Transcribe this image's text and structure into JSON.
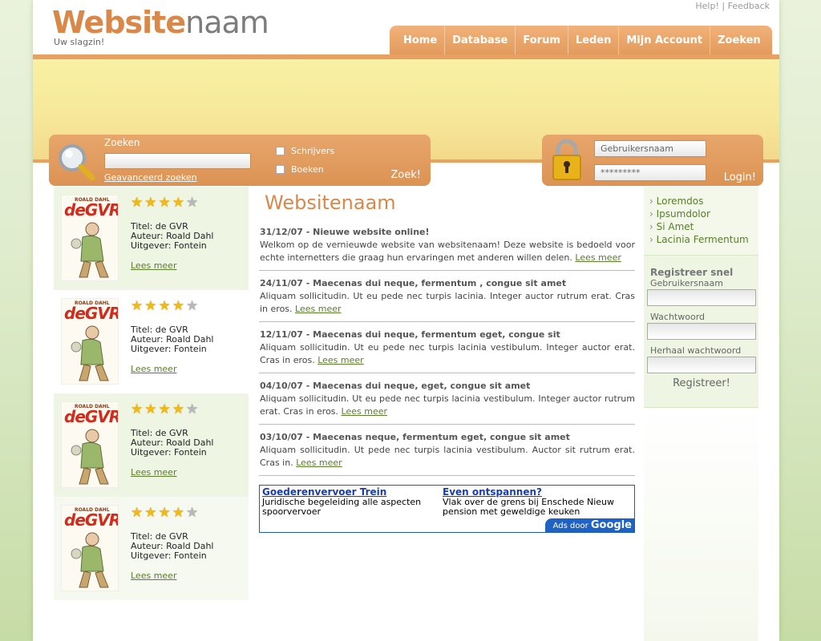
{
  "header": {
    "logo_part1": "Website",
    "logo_part2": "naam",
    "slogan": "Uw slagzin!",
    "toplinks": {
      "help": "Help!",
      "sep": "|",
      "feedback": "Feedback"
    }
  },
  "nav": {
    "items": [
      "Home",
      "Database",
      "Forum",
      "Leden",
      "Mijn Account",
      "Zoeken"
    ]
  },
  "search": {
    "label": "Zoeken",
    "advanced": "Geavanceerd zoeken",
    "options": [
      "Schrijvers",
      "Boeken"
    ],
    "button": "Zoek!"
  },
  "login": {
    "username_placeholder": "Gebruikersnaam",
    "password_value": "*********",
    "button": "Login!"
  },
  "books": [
    {
      "cover_author": "ROALD DAHL",
      "cover_title": "deGVR",
      "rating": 4,
      "max_rating": 5,
      "title": "Titel: de GVR",
      "author": "Auteur: Roald Dahl",
      "publisher": "Uitgever: Fontein",
      "more": "Lees meer"
    },
    {
      "cover_author": "ROALD DAHL",
      "cover_title": "deGVR",
      "rating": 4,
      "max_rating": 5,
      "title": "Titel: de GVR",
      "author": "Auteur: Roald Dahl",
      "publisher": "Uitgever: Fontein",
      "more": "Lees meer"
    },
    {
      "cover_author": "ROALD DAHL",
      "cover_title": "deGVR",
      "rating": 4,
      "max_rating": 5,
      "title": "Titel: de GVR",
      "author": "Auteur: Roald Dahl",
      "publisher": "Uitgever: Fontein",
      "more": "Lees meer"
    },
    {
      "cover_author": "ROALD DAHL",
      "cover_title": "deGVR",
      "rating": 4,
      "max_rating": 5,
      "title": "Titel: de GVR",
      "author": "Auteur: Roald Dahl",
      "publisher": "Uitgever: Fontein",
      "more": "Lees meer"
    }
  ],
  "main": {
    "heading": "Websitenaam",
    "news": [
      {
        "title": "31/12/07 - Nieuwe website online!",
        "body": "Welkom op de vernieuwde website van websitenaam! Deze website is bedoeld voor echte internetters die graag hun ervaringen met anderen willen delen.",
        "more": "Lees meer"
      },
      {
        "title": "24/11/07 - Maecenas dui neque, fermentum , congue sit amet",
        "body": "Aliquam sollicitudin. Ut eu pede nec turpis lacinia. Integer auctor rutrum erat. Cras in eros.",
        "more": "Lees meer"
      },
      {
        "title": "12/11/07 - Maecenas dui neque, fermentum eget, congue sit",
        "body": "Aliquam sollicitudin. Ut eu pede nec turpis lacinia vestibulum. Integer auctor erat. Cras in eros.",
        "more": "Lees meer"
      },
      {
        "title": "04/10/07 - Maecenas dui neque, eget, congue sit amet",
        "body": "Aliquam sollicitudin. Ut eu pede nec turpis lacinia vestibulum. Integer auctor rutrum erat. Cras in eros.",
        "more": "Lees meer"
      },
      {
        "title": "03/10/07 - Maecenas neque, fermentum eget, congue sit amet",
        "body": "Aliquam sollicitudin. Ut pede nec turpis lacinia vestibulum. Auctor sit rutrum erat. Cras in.",
        "more": "Lees meer"
      }
    ],
    "ads": [
      {
        "title": "Goederenvervoer Trein",
        "text": "Juridische begeleiding alle aspecten spoorvervoer"
      },
      {
        "title": "Even ontspannen?",
        "text": "Vlak over de grens bij Enschede Nieuw pension met geweldige keuken"
      }
    ],
    "ads_by": "Ads door",
    "ads_brand": "Google"
  },
  "sidebar": {
    "links": [
      "Loremdos",
      "Ipsumdolor",
      "Si Amet",
      "Lacinia Fermentum"
    ],
    "register": {
      "title": "Registreer snel",
      "username_label": "Gebruikersnaam",
      "password_label": "Wachtwoord",
      "repeat_label": "Herhaal wachtwoord",
      "button": "Registreer!"
    }
  },
  "colors": {
    "accent": "#e39a5c",
    "logo_orange": "#d9884a",
    "link_green": "#5a7c2c",
    "banner_yellow": "#f7e89a",
    "ad_blue": "#1a3db0"
  }
}
